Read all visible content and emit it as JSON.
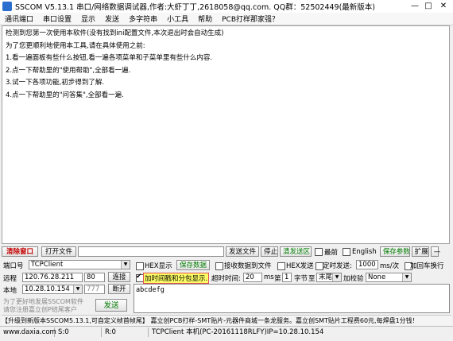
{
  "window": {
    "title": "SSCOM V5.13.1 串口/网络数据调试器,作者:大虾丁丁,2618058@qq.com. QQ群：52502449(最新版本)",
    "minimize": "—",
    "maximize": "□",
    "close": "✕"
  },
  "menu": [
    "通讯端口",
    "串口设置",
    "显示",
    "发送",
    "多字符串",
    "小工具",
    "帮助",
    "PCB打样那家强？"
  ],
  "output_lines": [
    "检测到您第一次使用本软件(没有找到ini配置文件,本次退出时会自动生成)",
    "为了您更顺利地使用本工具,请在具体使用之前:",
    "1.看一遍面板有些什么按钮,看一遍各项菜单和子菜单里有些什么内容.",
    "2.点一下帮助里的\"使用帮助\",全部看一遍.",
    "3.试一下各项功能,初步得到了解.",
    "4.点一下帮助里的\"问答集\",全部看一遍."
  ],
  "toolbar": {
    "clear_window": "清除窗口",
    "open_file": "打开文件",
    "send_file": "发送文件",
    "stop": "停止",
    "clear_send": "清发送区",
    "front_label": "最前",
    "english_label": "English",
    "save_params": "保存参数",
    "expand": "扩展",
    "minus": "—"
  },
  "net": {
    "port_label": "端口号",
    "port_value": "TCPClient",
    "remote_label": "远程",
    "remote_ip": "120.76.28.211",
    "remote_port": "80",
    "local_label": "本地",
    "local_ip": "10.28.10.154",
    "local_port": "777",
    "connect": "连接",
    "disconnect": "断开",
    "hint_line1": "为了更好地发展SSCOM软件",
    "hint_line2": "请您注册嘉立创P结尾客户",
    "send": "发送"
  },
  "options": {
    "hex_display": "HEX显示",
    "save_data": "保存数据",
    "recv_to_file": "接收数据到文件",
    "hex_send": "HEX发送",
    "timed_send": "定时发送:",
    "timed_value": "1000",
    "timed_unit": "ms/次",
    "add_crlf": "加回车换行",
    "timestamp": "加时间戳和分包显示.",
    "timeout_label": "超时时间:",
    "timeout_value": "20",
    "timeout_unit": "ms",
    "byte_prefix": "第",
    "byte_value": "1",
    "byte_label": "字节",
    "to_label": "至",
    "end_value": "末尾",
    "checksum_label": "加校验",
    "checksum_value": "None"
  },
  "send_text": "abcdefg",
  "banner": "【升级到新版本SSCOM5.13.1,可自定义帧首帧尾】   嘉立创PCB打样-SMT贴片-元器件商城一条龙服务。嘉立创SMT贴片工程费60元,每焊盘1分钱！",
  "status": {
    "site": "www.daxia.com",
    "sent": "S:0",
    "recv": "R:0",
    "conn": "TCPClient 本机(PC-20161118RLFY)IP=10.28.10.154"
  }
}
